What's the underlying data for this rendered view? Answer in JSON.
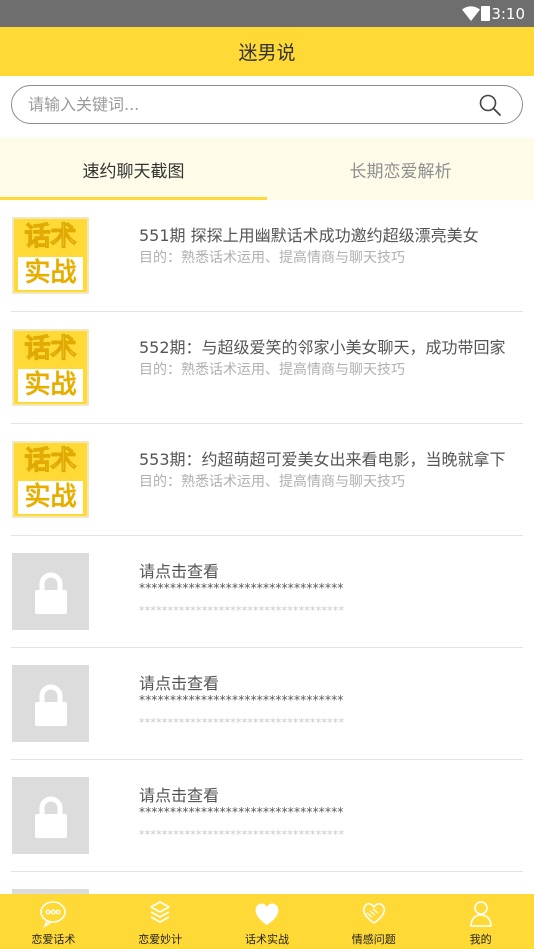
{
  "status_bar": {
    "time": "3:10",
    "icons": [
      "wifi-icon",
      "battery-icon"
    ]
  },
  "app_bar": {
    "title": "迷男说"
  },
  "search": {
    "placeholder": "请输入关键词...",
    "value": "",
    "icon": "search-icon"
  },
  "tabs": [
    {
      "label": "速约聊天截图",
      "active": true
    },
    {
      "label": "长期恋爱解析",
      "active": false
    }
  ],
  "list": {
    "badge_text": {
      "line1": "话术",
      "line2": "实战"
    },
    "items": [
      {
        "thumb": "badge",
        "title": "551期 探探上用幽默话术成功邀约超级漂亮美女",
        "subtitle": "目的：熟悉话术运用、提高情商与聊天技巧"
      },
      {
        "thumb": "badge",
        "title": "552期：与超级爱笑的邻家小美女聊天，成功带回家",
        "subtitle": "目的：熟悉话术运用、提高情商与聊天技巧"
      },
      {
        "thumb": "badge",
        "title": "553期：约超萌超可爱美女出来看电影，当晚就拿下",
        "subtitle": "目的：熟悉话术运用、提高情商与聊天技巧"
      },
      {
        "thumb": "lock",
        "title": "请点击查看",
        "stars1": "*********************************",
        "stars2": "************************************"
      },
      {
        "thumb": "lock",
        "title": "请点击查看",
        "stars1": "*********************************",
        "stars2": "************************************"
      },
      {
        "thumb": "lock",
        "title": "请点击查看",
        "stars1": "*********************************",
        "stars2": "************************************"
      },
      {
        "thumb": "lock",
        "title": "",
        "stars1": "",
        "stars2": ""
      }
    ]
  },
  "bottom_nav": [
    {
      "label": "恋爱话术",
      "icon": "chat-bubble-icon"
    },
    {
      "label": "恋爱妙计",
      "icon": "book-stack-icon"
    },
    {
      "label": "话术实战",
      "icon": "heart-icon"
    },
    {
      "label": "情感问题",
      "icon": "handshake-heart-icon"
    },
    {
      "label": "我的",
      "icon": "user-icon"
    }
  ]
}
